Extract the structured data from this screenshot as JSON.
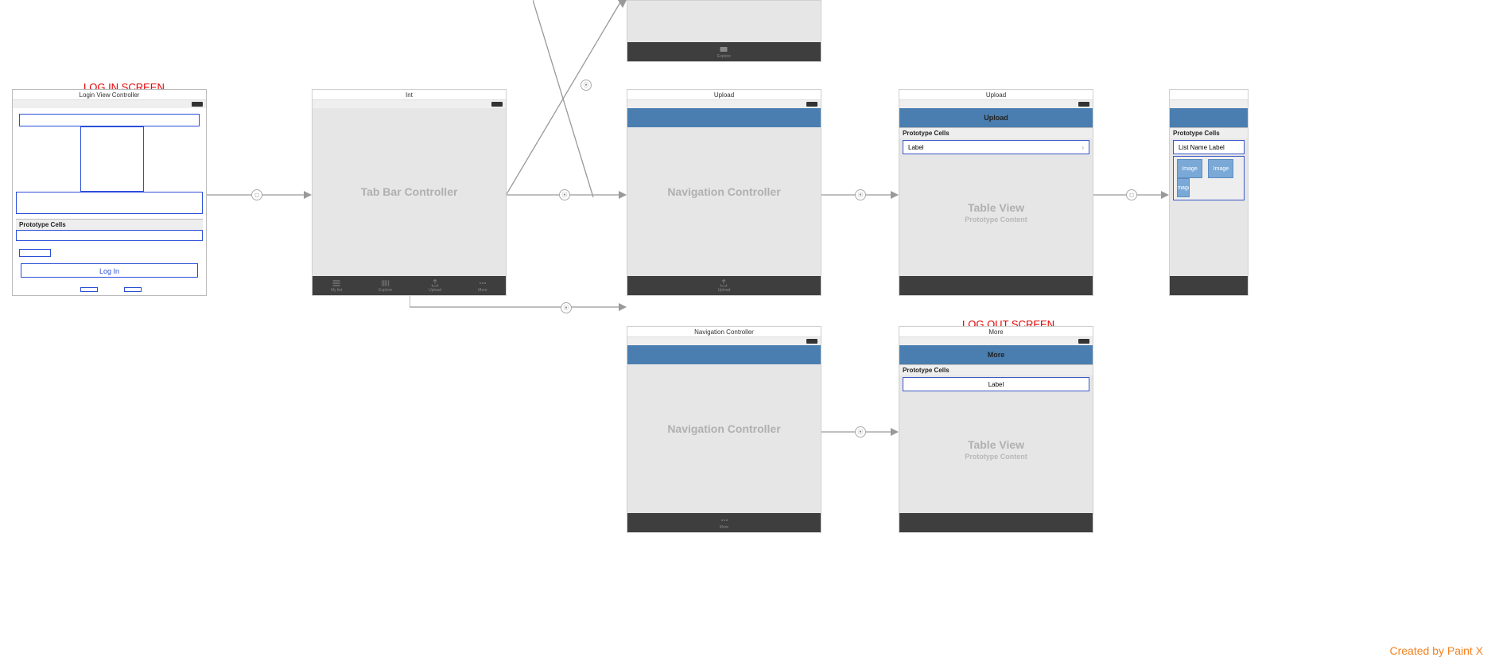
{
  "annotations": {
    "login": "LOG IN SCREEN",
    "logout": "LOG OUT SCREEN"
  },
  "scenes": {
    "login": {
      "title": "Login View Controller",
      "prototype_header": "Prototype Cells",
      "login_button": "Log In"
    },
    "tabbar": {
      "title": "Int",
      "placeholder": "Tab Bar Controller",
      "tabs": [
        {
          "label": "My list"
        },
        {
          "label": "Explore"
        },
        {
          "label": "Upload"
        },
        {
          "label": "More"
        }
      ]
    },
    "topclip": {
      "tab_label": "Explore"
    },
    "nav_upload": {
      "title": "Upload",
      "placeholder": "Navigation Controller",
      "tab_action": "Upload"
    },
    "table_upload": {
      "title": "Upload",
      "nav_title": "Upload",
      "prototype_header": "Prototype Cells",
      "cell_label": "Label",
      "placeholder": "Table View",
      "placeholder_sub": "Prototype Content"
    },
    "listdetail": {
      "prototype_header": "Prototype Cells",
      "list_name_label": "List Name Label",
      "image_chip": "Image"
    },
    "nav_more": {
      "title": "Navigation Controller",
      "placeholder": "Navigation Controller",
      "tab_label": "More"
    },
    "table_more": {
      "title": "More",
      "nav_title": "More",
      "prototype_header": "Prototype Cells",
      "cell_label": "Label",
      "placeholder": "Table View",
      "placeholder_sub": "Prototype Content"
    }
  },
  "footer": "Created by Paint X"
}
